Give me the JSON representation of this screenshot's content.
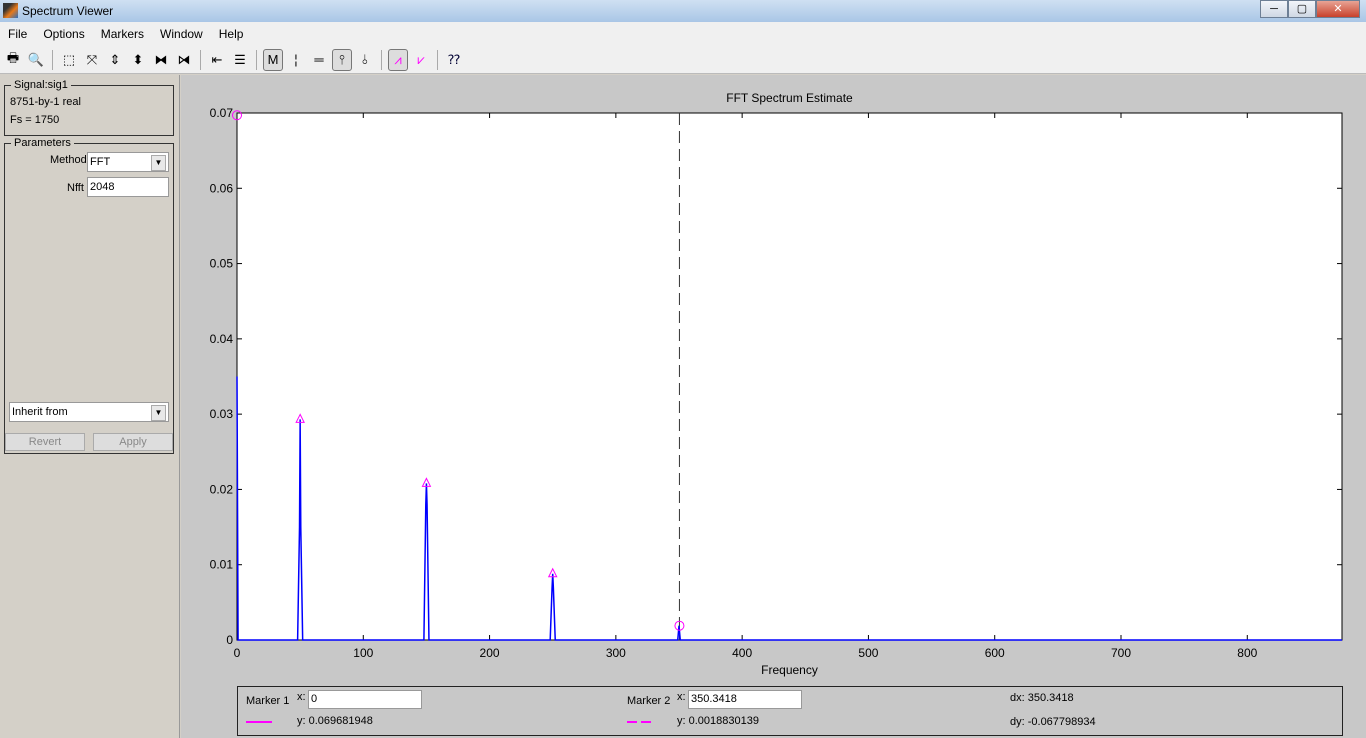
{
  "window": {
    "title": "Spectrum Viewer",
    "minimize": "─",
    "maximize": "▢",
    "close": "✕"
  },
  "menu": [
    "File",
    "Options",
    "Markers",
    "Window",
    "Help"
  ],
  "toolbar": {
    "icons": [
      "print-icon",
      "print-preview-icon",
      "zoom-box-icon",
      "full-view-icon",
      "zoom-y-in-icon",
      "zoom-y-out-icon",
      "zoom-x-in-icon",
      "zoom-x-out-icon",
      "set-link-icon",
      "line-properties-icon",
      "markers-onoff-icon",
      "vertical-markers-icon",
      "horizontal-markers-icon",
      "track-markers-icon",
      "slope-markers-icon",
      "peaks-icon",
      "valleys-icon",
      "whats-this-icon"
    ],
    "glyphs": [
      "🖶",
      "🔍",
      "⬚",
      "⤧",
      "⇕",
      "⬍",
      "⧓",
      "⧒",
      "⇤",
      "☰",
      "M",
      "¦",
      "═",
      "⫯",
      "⫰",
      "⩘",
      "⩗",
      "⁇"
    ]
  },
  "signal": {
    "legend": "Signal:sig1",
    "size": "8751-by-1 real",
    "fs": "Fs = 1750"
  },
  "parameters": {
    "legend": "Parameters",
    "method_label": "Method",
    "method_value": "FFT",
    "nfft_label": "Nfft",
    "nfft_value": "2048",
    "inherit_value": "Inherit from",
    "revert": "Revert",
    "apply": "Apply"
  },
  "chart_data": {
    "type": "line",
    "title": "FFT Spectrum Estimate",
    "xlabel": "Frequency",
    "ylabel": "",
    "xlim": [
      0,
      875
    ],
    "ylim": [
      0,
      0.07
    ],
    "xticks": [
      0,
      100,
      200,
      300,
      400,
      500,
      600,
      700,
      800
    ],
    "yticks": [
      "0",
      "0.01",
      "0.02",
      "0.03",
      "0.04",
      "0.05",
      "0.06",
      "0.07"
    ],
    "line_color": "#0000ff",
    "points": [
      [
        0,
        0.035
      ],
      [
        0.85,
        0
      ],
      [
        48,
        0
      ],
      [
        49.5,
        0.015
      ],
      [
        50,
        0.0293
      ],
      [
        50.5,
        0.015
      ],
      [
        52,
        0
      ],
      [
        148,
        0
      ],
      [
        149.5,
        0.018
      ],
      [
        150,
        0.0208
      ],
      [
        150.5,
        0.018
      ],
      [
        152,
        0
      ],
      [
        248,
        0
      ],
      [
        249.5,
        0.007
      ],
      [
        250,
        0.0088
      ],
      [
        250.5,
        0.007
      ],
      [
        252,
        0
      ],
      [
        349,
        0
      ],
      [
        350,
        0.0019
      ],
      [
        351,
        0
      ],
      [
        875,
        0
      ]
    ],
    "peak_markers": [
      [
        50,
        0.0293
      ],
      [
        150,
        0.0208
      ],
      [
        250,
        0.0088
      ]
    ],
    "marker_points": [
      [
        0,
        0.0697
      ],
      [
        350.3418,
        0.0019
      ]
    ],
    "marker_color": "#ff00ff",
    "vertical_marker_x": 350.3418
  },
  "markers": {
    "m1_label": "Marker 1",
    "m1_x_label": "x:",
    "m1_x": "0",
    "m1_y": "y: 0.069681948",
    "m2_label": "Marker 2",
    "m2_x_label": "x:",
    "m2_x": "350.3418",
    "m2_y": "y: 0.0018830139",
    "dx": "dx: 350.3418",
    "dy": "dy: -0.067798934"
  }
}
